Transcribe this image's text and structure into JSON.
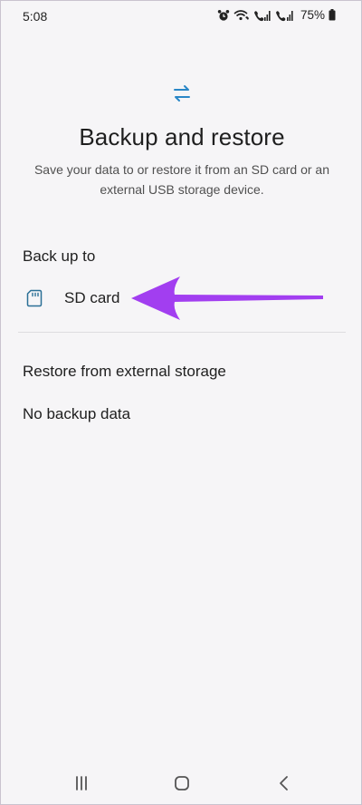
{
  "status_bar": {
    "time": "5:08",
    "battery": "75%"
  },
  "header": {
    "icon": "transfer-arrows-icon",
    "title": "Backup and restore",
    "subtitle": "Save your data to or restore it from an SD card or an external USB storage device."
  },
  "backup_section": {
    "title": "Back up to",
    "items": [
      {
        "icon": "sd-card-icon",
        "label": "SD card"
      }
    ]
  },
  "restore_section": {
    "title": "Restore from external storage",
    "empty_message": "No backup data"
  },
  "annotation": {
    "icon": "pointer-arrow-icon",
    "color": "#a23ef0"
  },
  "nav_bar": {
    "recent": "recent-apps-icon",
    "home": "home-icon",
    "back": "back-icon"
  },
  "colors": {
    "accent": "#2a87c7",
    "background": "#f6f5f7"
  }
}
